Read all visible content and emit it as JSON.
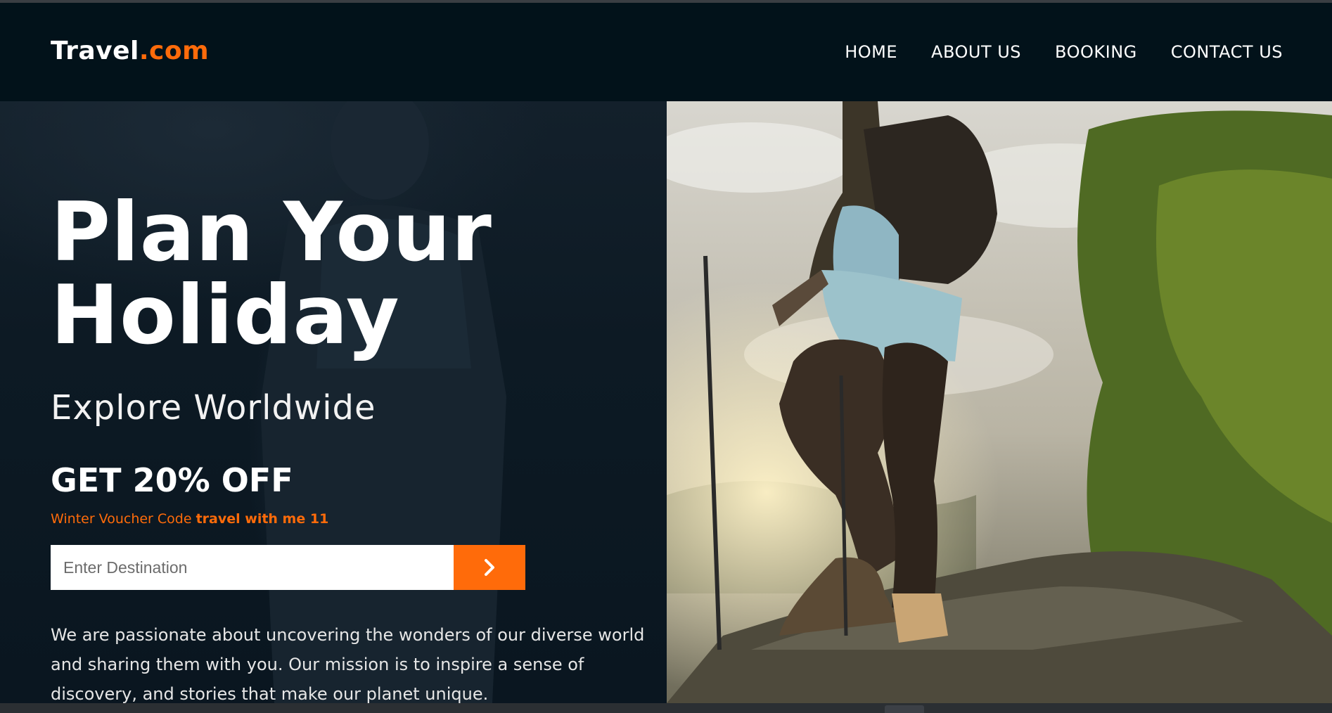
{
  "header": {
    "logo_main": "Travel",
    "logo_accent": ".com",
    "nav": [
      {
        "label": "HOME"
      },
      {
        "label": "ABOUT US"
      },
      {
        "label": "BOOKING"
      },
      {
        "label": "CONTACT US"
      }
    ]
  },
  "hero": {
    "title_line1": "Plan Your",
    "title_line2": "Holiday",
    "subtitle": "Explore Worldwide",
    "offer": "GET 20% OFF",
    "voucher_label": "Winter Voucher Code ",
    "voucher_code": "travel with me 11",
    "search_placeholder": "Enter Destination",
    "search_button_icon": "chevron-right-icon",
    "description": "We are passionate about uncovering the wonders of our diverse world and sharing them with you. Our mission is to inspire a sense of discovery, and stories that make our planet unique."
  },
  "colors": {
    "accent": "#ff6b0a",
    "header_bg": "#02121a",
    "text": "#ffffff"
  }
}
